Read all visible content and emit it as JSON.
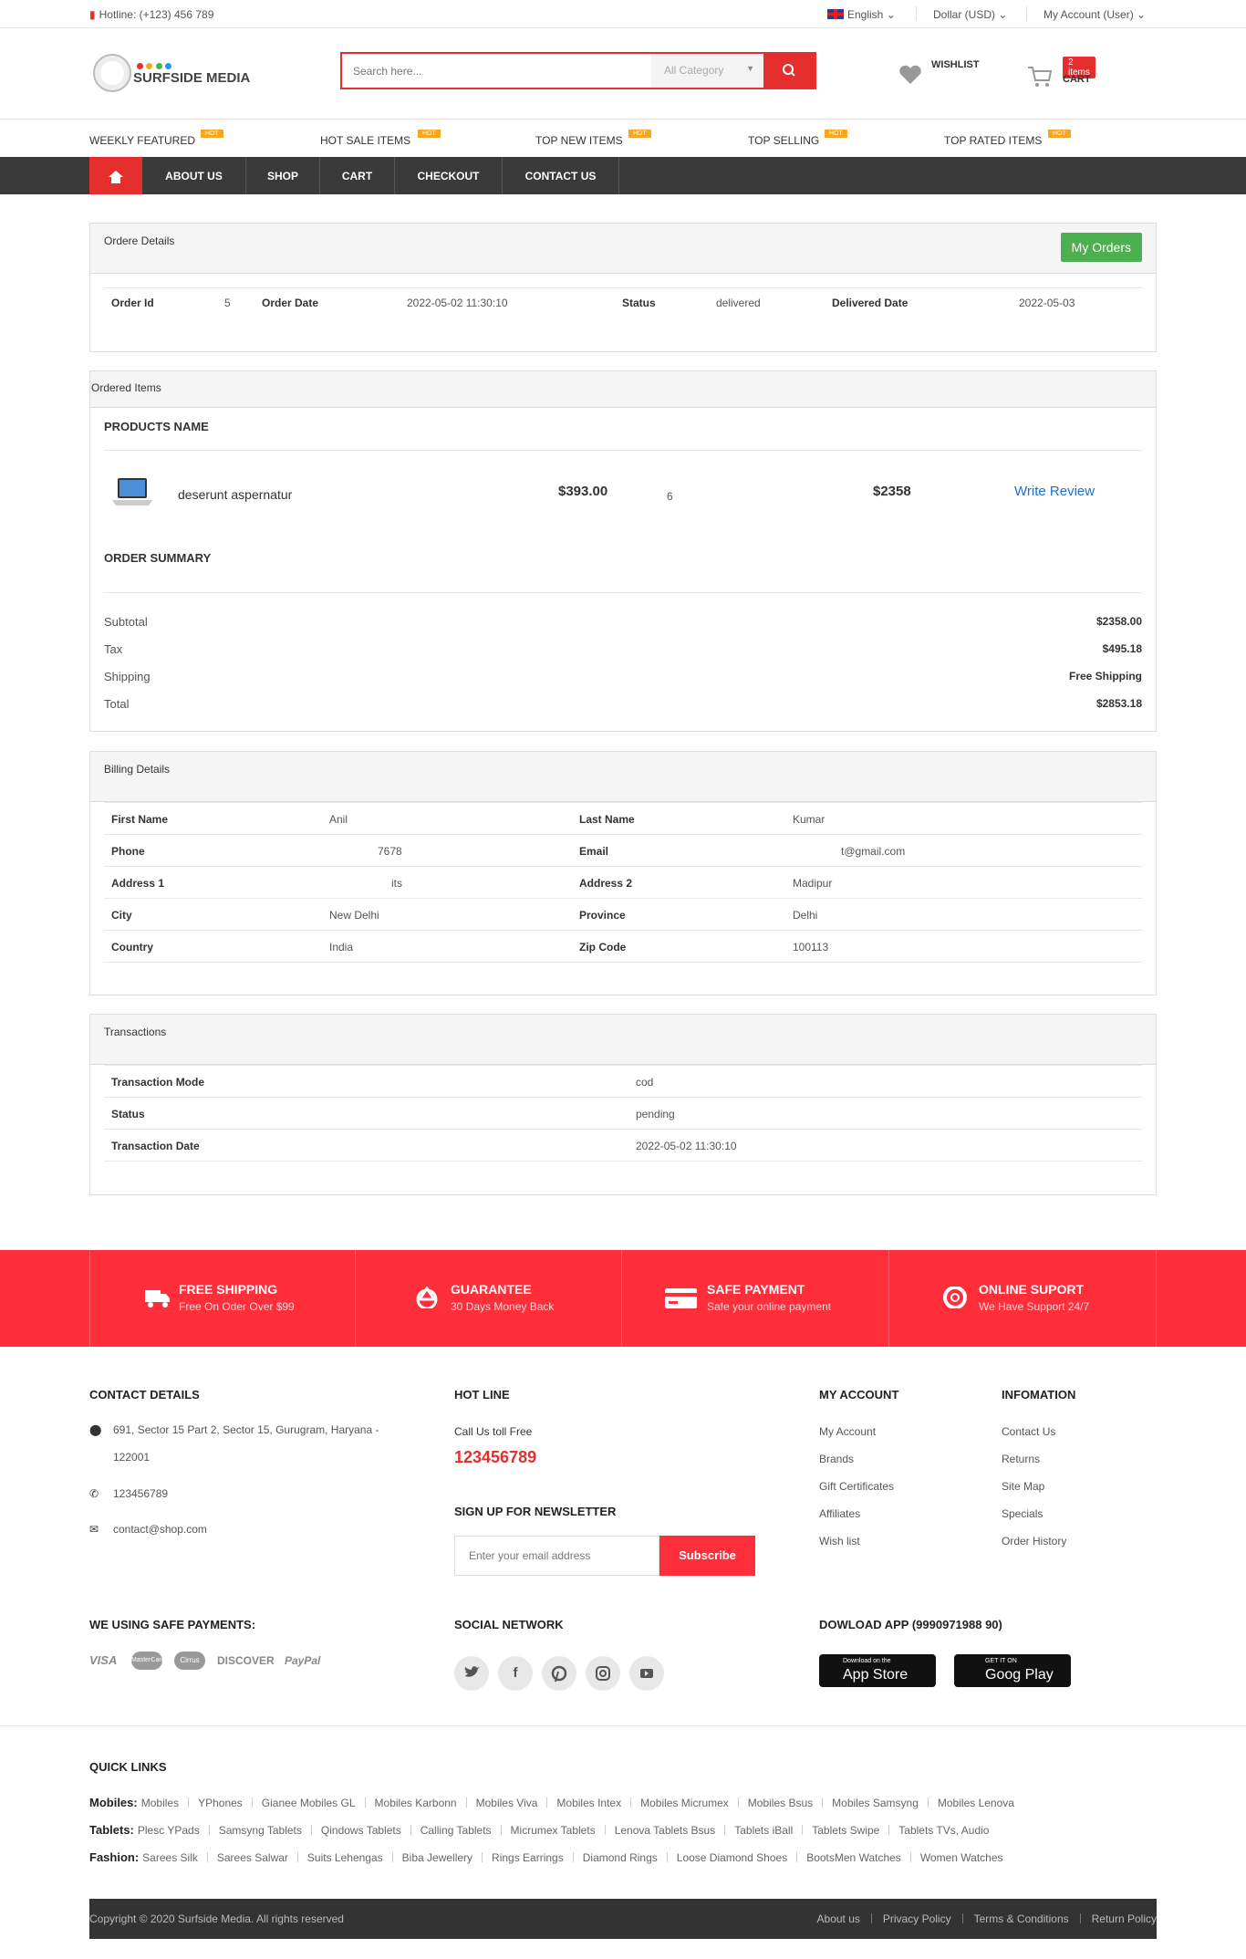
{
  "topbar": {
    "hotline": "Hotline: (+123) 456 789",
    "language": "English",
    "currency": "Dollar (USD)",
    "account": "My Account (User)"
  },
  "header": {
    "logo_text": "SURFSIDE MEDIA",
    "search_placeholder": "Search here...",
    "category": "All Category",
    "wishlist_label": "WISHLIST",
    "cart_count": "2 items",
    "cart_label": "CART"
  },
  "hot_nav": [
    {
      "label": "WEEKLY FEATURED",
      "tag": "HOT"
    },
    {
      "label": "HOT SALE ITEMS",
      "tag": "HOT"
    },
    {
      "label": "TOP NEW ITEMS",
      "tag": "HOT"
    },
    {
      "label": "TOP SELLING",
      "tag": "HOT"
    },
    {
      "label": "TOP RATED ITEMS",
      "tag": "HOT"
    }
  ],
  "main_nav": [
    "ABOUT US",
    "SHOP",
    "CART",
    "CHECKOUT",
    "CONTACT US"
  ],
  "order_details": {
    "title": "Ordere Details",
    "my_orders_btn": "My Orders",
    "order_id_label": "Order Id",
    "order_id": "5",
    "order_date_label": "Order Date",
    "order_date": "2022-05-02 11:30:10",
    "status_label": "Status",
    "status": "delivered",
    "delivered_label": "Delivered Date",
    "delivered_date": "2022-05-03"
  },
  "ordered_items": {
    "title": "Ordered Items",
    "products_heading": "PRODUCTS NAME",
    "item": {
      "name": "deserunt aspernatur",
      "price": "$393.00",
      "qty": "6",
      "subtotal": "$2358",
      "review": "Write Review"
    },
    "summary_heading": "ORDER SUMMARY",
    "summary": [
      {
        "label": "Subtotal",
        "value": "$2358.00"
      },
      {
        "label": "Tax",
        "value": "$495.18"
      },
      {
        "label": "Shipping",
        "value": "Free Shipping"
      },
      {
        "label": "Total",
        "value": "$2853.18"
      }
    ]
  },
  "billing": {
    "title": "Billing Details",
    "rows": [
      {
        "l1": "First Name",
        "v1": "Anil",
        "l2": "Last Name",
        "v2": "Kumar"
      },
      {
        "l1": "Phone",
        "v1": "7678",
        "l2": "Email",
        "v2": "t@gmail.com"
      },
      {
        "l1": "Address 1",
        "v1": "its",
        "l2": "Address 2",
        "v2": "Madipur"
      },
      {
        "l1": "City",
        "v1": "New Delhi",
        "l2": "Province",
        "v2": "Delhi"
      },
      {
        "l1": "Country",
        "v1": "India",
        "l2": "Zip Code",
        "v2": "100113"
      }
    ]
  },
  "transactions": {
    "title": "Transactions",
    "rows": [
      {
        "label": "Transaction Mode",
        "value": "cod"
      },
      {
        "label": "Status",
        "value": "pending"
      },
      {
        "label": "Transaction Date",
        "value": "2022-05-02 11:30:10"
      }
    ]
  },
  "features": [
    {
      "title": "FREE SHIPPING",
      "sub": "Free On Oder Over $99",
      "icon": "truck-icon"
    },
    {
      "title": "GUARANTEE",
      "sub": "30 Days Money Back",
      "icon": "recycle-icon"
    },
    {
      "title": "SAFE PAYMENT",
      "sub": "Safe your online payment",
      "icon": "credit-card-icon"
    },
    {
      "title": "ONLINE SUPORT",
      "sub": "We Have Support 24/7",
      "icon": "lifebuoy-icon"
    }
  ],
  "footer": {
    "contact_heading": "CONTACT DETAILS",
    "address_line1": "691, Sector 15 Part 2, Sector 15, Gurugram, Haryana -",
    "address_line2": "122001",
    "phone": "123456789",
    "email": "contact@shop.com",
    "hotline_heading": "HOT LINE",
    "call_text": "Call Us toll Free",
    "hotline_number": "123456789",
    "newsletter_heading": "SIGN UP FOR NEWSLETTER",
    "newsletter_placeholder": "Enter your email address",
    "subscribe": "Subscribe",
    "account_heading": "MY ACCOUNT",
    "account_links": [
      "My Account",
      "Brands",
      "Gift Certificates",
      "Affiliates",
      "Wish list"
    ],
    "info_heading": "INFOMATION",
    "info_links": [
      "Contact Us",
      "Returns",
      "Site Map",
      "Specials",
      "Order History"
    ],
    "payments_heading": "WE USING SAFE PAYMENTS:",
    "payments": [
      "VISA",
      "MasterCard",
      "Cirrus",
      "DISCOVER",
      "PayPal"
    ],
    "social_heading": "SOCIAL NETWORK",
    "social": [
      "twitter-icon",
      "facebook-icon",
      "pinterest-icon",
      "instagram-icon",
      "youtube-icon"
    ],
    "app_heading": "DOWLOAD APP (9990971988 90)",
    "app_store_small": "Download on the",
    "app_store": "App Store",
    "google_small": "GET IT ON",
    "google": "Goog Play"
  },
  "quick_links": {
    "heading": "QUICK LINKS",
    "groups": [
      {
        "name": "Mobiles:",
        "links": [
          "Mobiles",
          "YPhones",
          "Gianee Mobiles GL",
          "Mobiles Karbonn",
          "Mobiles Viva",
          "Mobiles Intex",
          "Mobiles Micrumex",
          "Mobiles Bsus",
          "Mobiles Samsyng",
          "Mobiles Lenova"
        ]
      },
      {
        "name": "Tablets:",
        "links": [
          "Plesc YPads",
          "Samsyng Tablets",
          "Qindows Tablets",
          "Calling Tablets",
          "Micrumex Tablets",
          "Lenova Tablets Bsus",
          "Tablets iBall",
          "Tablets Swipe",
          "Tablets TVs, Audio"
        ]
      },
      {
        "name": "Fashion:",
        "links": [
          "Sarees Silk",
          "Sarees Salwar",
          "Suits Lehengas",
          "Biba Jewellery",
          "Rings Earrings",
          "Diamond Rings",
          "Loose Diamond Shoes",
          "BootsMen Watches",
          "Women Watches"
        ]
      }
    ]
  },
  "bottom": {
    "copyright": "Copyright © 2020 Surfside Media. All rights reserved",
    "links": [
      "About us",
      "Privacy Policy",
      "Terms & Conditions",
      "Return Policy"
    ]
  }
}
